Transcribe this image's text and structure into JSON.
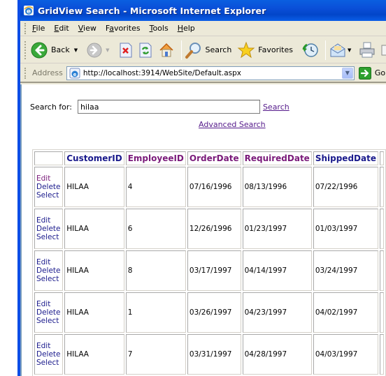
{
  "window": {
    "title": "GridView Search - Microsoft Internet Explorer"
  },
  "menubar": {
    "items": [
      {
        "label": "File",
        "accel": "F"
      },
      {
        "label": "Edit",
        "accel": "E"
      },
      {
        "label": "View",
        "accel": "V"
      },
      {
        "label": "Favorites",
        "accel": "a"
      },
      {
        "label": "Tools",
        "accel": "T"
      },
      {
        "label": "Help",
        "accel": "H"
      }
    ]
  },
  "toolbar": {
    "back_label": "Back",
    "search_label": "Search",
    "favorites_label": "Favorites"
  },
  "addressbar": {
    "label": "Address",
    "url": "http://localhost:3914/WebSite/Default.aspx",
    "go_label": "Go"
  },
  "page": {
    "search_label": "Search for:",
    "search_value": "hilaa",
    "search_link": "Search",
    "advanced_search_link": "Advanced Search",
    "grid": {
      "columns": [
        "",
        "CustomerID",
        "EmployeeID",
        "OrderDate",
        "RequiredDate",
        "ShippedDate"
      ],
      "command_labels": {
        "edit": "Edit",
        "delete": "Delete",
        "select": "Select"
      },
      "rows": [
        {
          "CustomerID": "HILAA",
          "EmployeeID": "4",
          "OrderDate": "07/16/1996",
          "RequiredDate": "08/13/1996",
          "ShippedDate": "07/22/1996"
        },
        {
          "CustomerID": "HILAA",
          "EmployeeID": "6",
          "OrderDate": "12/26/1996",
          "RequiredDate": "01/23/1997",
          "ShippedDate": "01/03/1997"
        },
        {
          "CustomerID": "HILAA",
          "EmployeeID": "8",
          "OrderDate": "03/17/1997",
          "RequiredDate": "04/14/1997",
          "ShippedDate": "03/24/1997"
        },
        {
          "CustomerID": "HILAA",
          "EmployeeID": "1",
          "OrderDate": "03/26/1997",
          "RequiredDate": "04/23/1997",
          "ShippedDate": "04/02/1997"
        },
        {
          "CustomerID": "HILAA",
          "EmployeeID": "7",
          "OrderDate": "03/31/1997",
          "RequiredDate": "04/28/1997",
          "ShippedDate": "04/03/1997"
        }
      ]
    }
  }
}
